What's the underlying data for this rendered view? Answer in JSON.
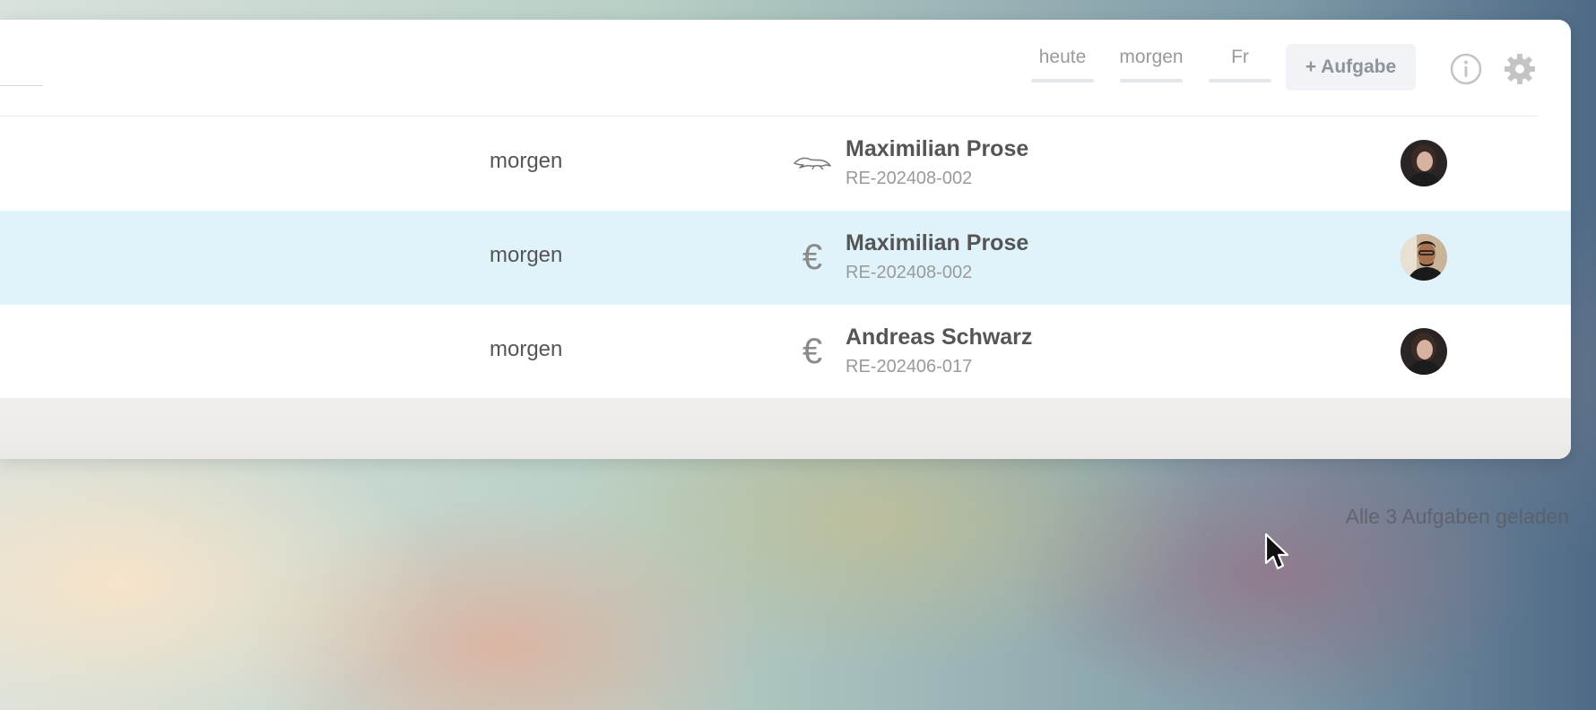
{
  "header": {
    "filters": [
      "heute",
      "morgen",
      "Fr"
    ],
    "add_task_label": "+ Aufgabe",
    "icons": [
      "info-icon",
      "gear-icon"
    ]
  },
  "tasks": [
    {
      "due": "morgen",
      "type_icon": "jaguar-car-logo",
      "name": "Maximilian Prose",
      "reference": "RE-202408-002",
      "avatar": "woman-avatar",
      "selected": false
    },
    {
      "due": "morgen",
      "type_icon": "euro-icon",
      "type_glyph": "€",
      "name": "Maximilian Prose",
      "reference": "RE-202408-002",
      "avatar": "man-avatar",
      "selected": true
    },
    {
      "due": "morgen",
      "type_icon": "euro-icon",
      "type_glyph": "€",
      "name": "Andreas Schwarz",
      "reference": "RE-202406-017",
      "avatar": "woman-avatar",
      "selected": false
    }
  ],
  "status": {
    "loaded_text": "Alle 3 Aufgaben geladen"
  },
  "colors": {
    "selected_row": "#e0f3fb",
    "panel": "#ffffff",
    "muted_text": "#9a9a9a"
  }
}
